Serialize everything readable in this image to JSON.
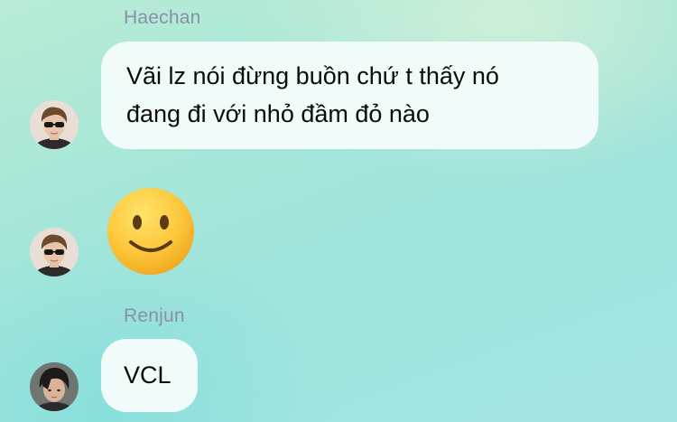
{
  "messages": [
    {
      "sender": "Haechan",
      "lines": [
        "Vãi lz nói đừng buồn chứ t thấy nó",
        "đang đi với nhỏ đầm đỏ nào"
      ],
      "avatar": "sunglasses-avatar"
    },
    {
      "emoji": "slightly-smiling-face-icon",
      "avatar": "sunglasses-avatar"
    },
    {
      "sender": "Renjun",
      "lines": [
        "VCL"
      ],
      "avatar": "dark-hair-avatar"
    }
  ],
  "colors": {
    "bubble": "#f1fbf9",
    "sender_name": "#8a8fa8",
    "background": "#a6e6d8"
  }
}
